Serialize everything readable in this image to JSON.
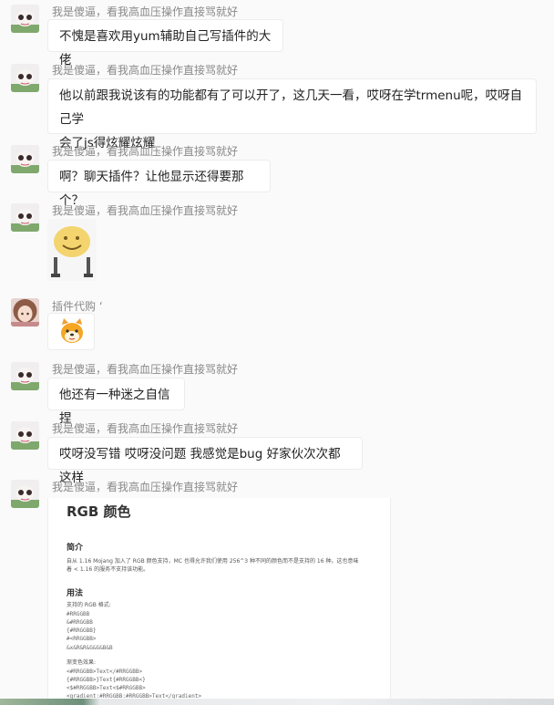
{
  "messages": [
    {
      "sender": "我是傻逼，看我高血压操作直接骂就好",
      "text": "不愧是喜欢用yum辅助自己写插件的大佬"
    },
    {
      "sender": "我是傻逼，看我高血压操作直接骂就好",
      "line1": "他以前跟我说该有的功能都有了可以开了，这几天一看，哎呀在学trmenu呢，哎呀自己学",
      "line2": "会了js得炫耀炫耀"
    },
    {
      "sender": "我是傻逼，看我高血压操作直接骂就好",
      "text": "啊？聊天插件？让他显示还得要那个？"
    },
    {
      "sender": "我是傻逼，看我高血压操作直接骂就好",
      "sticker": "smiley-face-sticker"
    },
    {
      "sender": "插件代购 ‘",
      "sticker": "dog-emoji-sticker"
    },
    {
      "sender": "我是傻逼，看我高血压操作直接骂就好",
      "text": "他还有一种迷之自信捏"
    },
    {
      "sender": "我是傻逼，看我高血压操作直接骂就好",
      "text": "哎呀没写错 哎呀没问题 我感觉是bug 好家伙次次都这样"
    },
    {
      "sender": "我是傻逼，看我高血压操作直接骂就好"
    }
  ],
  "doc": {
    "title": "RGB 颜色",
    "section1": "简介",
    "intro_line1": "自从 1.16 Mojang 加入了 RGB 颜色支持，MC 也得允许我们使用 256^3 种不同的颜色而不是支持的 16 种。这也意味",
    "intro_line2": "着 < 1.16 的服务不支持该功能。",
    "section2": "用法",
    "formats_label": "支持的 RGB 格式:",
    "formats": [
      "#RRGGBB",
      "&#RRGGBB",
      "{#RRGGBB}",
      "#<RRGGBB>",
      "&x&R&R&G&G&B&B"
    ],
    "gradient_label": "渐变色效果:",
    "gradients": [
      "<#RRGGBB>Text</#RRGGBB>",
      "{#RRGGBB>}Text{#RRGGBB<}",
      "<$#RRGGBB>Text<$#RRGGBB>",
      "<gradient:#RRGGBB:#RRGGBB>Text</gradient>"
    ]
  },
  "colors": {
    "background": "#fafafa",
    "bubble": "#ffffff",
    "sender": "#8a8a8a",
    "text": "#222222"
  }
}
